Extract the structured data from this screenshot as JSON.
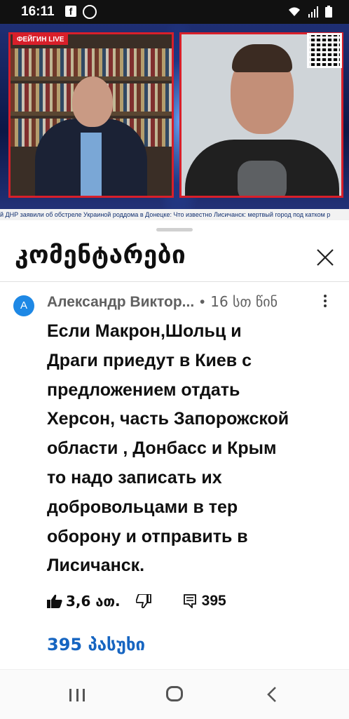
{
  "status_bar": {
    "time": "16:11",
    "icons": [
      "facebook-icon",
      "camera-icon",
      "wifi-icon",
      "signal-icon",
      "battery-icon"
    ]
  },
  "video": {
    "channel_logo": "ФЕЙГИН LIVE",
    "ticker": "й ДНР заявили об обстреле Украиной роддома в Донецке: Что известно  Лисичанск: мертвый город под катком р"
  },
  "comments_sheet": {
    "title": "კომენტარები",
    "close_icon": "close-icon"
  },
  "comment": {
    "avatar_letter": "A",
    "author": "Александр Виктор...",
    "separator": "•",
    "time": "16 სთ წინ",
    "body_lines": [
      "Если Макрон,Шольц и",
      "Драги приедут в Киев с",
      "предложением отдать",
      "Херсон, часть Запорожской",
      "области , Донбасс и Крым",
      "то надо записать их",
      "добровольцами в тер",
      "оборону и отправить в",
      "Лисичанск."
    ],
    "likes": "3,6 ათ.",
    "reply_count": "395",
    "replies_link": "395 პასუხი"
  },
  "colors": {
    "accent_red": "#d81f2a",
    "link_blue": "#1665c1",
    "avatar_blue": "#1e88e5"
  }
}
